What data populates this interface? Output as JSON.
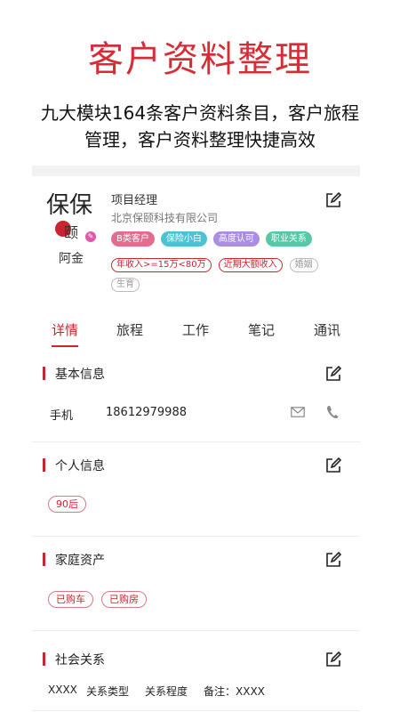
{
  "promo": {
    "title": "客户资料整理",
    "subtitle": "九大模块164条客户资料条目，客户旅程管理，客户资料整理快捷高效"
  },
  "customer": {
    "name": "阿金",
    "logo_text": "保保",
    "logo_text2": "颐",
    "job_title": "项目经理",
    "company": "北京保颐科技有限公司",
    "tags": [
      {
        "label": "B类客户",
        "color": "#e46a8e"
      },
      {
        "label": "保险小白",
        "color": "#4cc3d4"
      },
      {
        "label": "高度认可",
        "color": "#a98ee2"
      },
      {
        "label": "职业关系",
        "color": "#58c7a5"
      }
    ],
    "outline_tags": [
      {
        "label": "年收入>=15万<80万",
        "color": "#c9242f"
      },
      {
        "label": "近期大额收入",
        "color": "#c9242f"
      },
      {
        "label": "婚姻",
        "color": "#999999"
      },
      {
        "label": "生育",
        "color": "#999999"
      }
    ]
  },
  "tabs": [
    "详情",
    "旅程",
    "工作",
    "笔记",
    "通讯"
  ],
  "active_tab": "详情",
  "sections": {
    "basic": {
      "title": "基本信息",
      "phone_label": "手机",
      "phone_value": "18612979988"
    },
    "personal": {
      "title": "个人信息",
      "pills": [
        "90后"
      ]
    },
    "family": {
      "title": "家庭资产",
      "pills": [
        "已购车",
        "已购房"
      ]
    },
    "social": {
      "title": "社会关系",
      "row": [
        "XXXX",
        "关系类型",
        "关系程度",
        "备注：XXXX"
      ]
    }
  },
  "icons": {
    "edit": "edit-icon",
    "mail": "mail-icon",
    "phone": "phone-icon"
  },
  "colors": {
    "accent": "#c9242f",
    "promo_title": "#d62c35"
  }
}
